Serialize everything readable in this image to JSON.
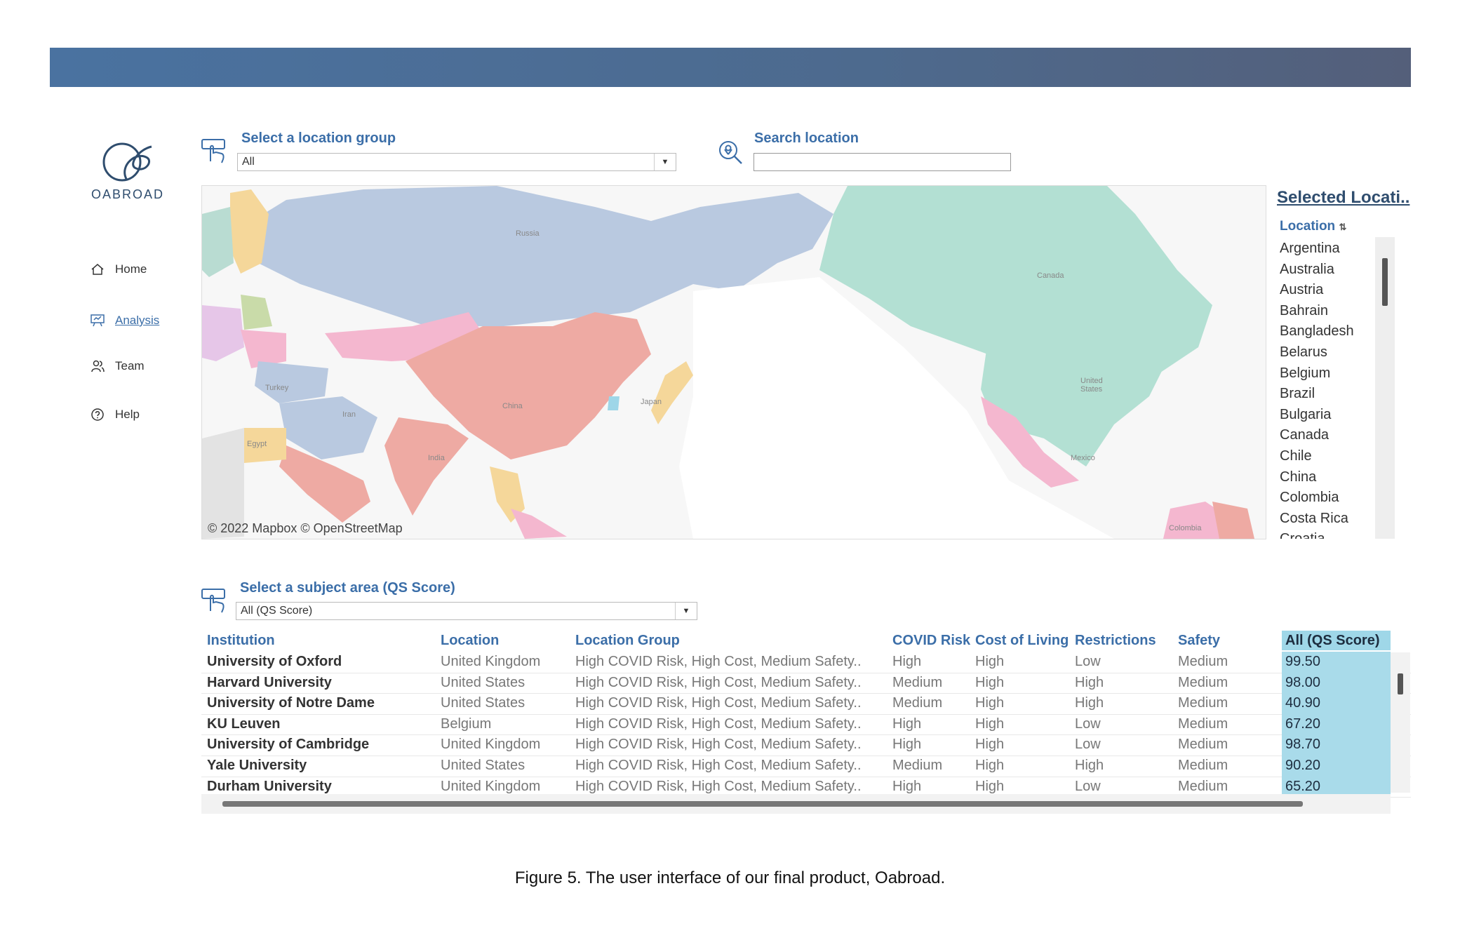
{
  "app": {
    "brand": "OABROAD"
  },
  "colors": {
    "topbar": "#4d6a8e",
    "accent": "#3b6ea8",
    "score_bg": "#a9dbea"
  },
  "nav": {
    "items": [
      {
        "label": "Home",
        "icon": "home-icon"
      },
      {
        "label": "Analysis",
        "icon": "presentation-icon",
        "active": true
      },
      {
        "label": "Team",
        "icon": "team-icon"
      },
      {
        "label": "Help",
        "icon": "help-icon"
      }
    ]
  },
  "filters": {
    "location_group": {
      "label": "Select a location group",
      "value": "All"
    },
    "search": {
      "label": "Search location",
      "value": ""
    },
    "subject": {
      "label": "Select a subject area (QS Score)",
      "value": "All (QS Score)"
    }
  },
  "map": {
    "credit": "© 2022 Mapbox © OpenStreetMap",
    "labels": [
      "Russia",
      "Canada",
      "United States",
      "China",
      "India",
      "Iran",
      "Turkey",
      "Egypt",
      "Japan",
      "Mexico",
      "Colombia"
    ]
  },
  "selected": {
    "title": "Selected Locati..",
    "column": "Location",
    "sort_icon": "sort-icon",
    "locations": [
      "Argentina",
      "Australia",
      "Austria",
      "Bahrain",
      "Bangladesh",
      "Belarus",
      "Belgium",
      "Brazil",
      "Bulgaria",
      "Canada",
      "Chile",
      "China",
      "Colombia",
      "Costa Rica",
      "Croatia"
    ]
  },
  "table": {
    "columns": [
      "Institution",
      "Location",
      "Location Group",
      "COVID Risk",
      "Cost of Living",
      "Restrictions",
      "Safety",
      "All (QS Score)"
    ],
    "rows": [
      [
        "University of Oxford",
        "United Kingdom",
        "High COVID Risk, High Cost, Medium Safety..",
        "High",
        "High",
        "Low",
        "Medium",
        "99.50"
      ],
      [
        "Harvard University",
        "United States",
        "High COVID Risk, High Cost, Medium Safety..",
        "Medium",
        "High",
        "High",
        "Medium",
        "98.00"
      ],
      [
        "University of Notre Dame",
        "United States",
        "High COVID Risk, High Cost, Medium Safety..",
        "Medium",
        "High",
        "High",
        "Medium",
        "40.90"
      ],
      [
        "KU Leuven",
        "Belgium",
        "High COVID Risk, High Cost, Medium Safety..",
        "High",
        "High",
        "Low",
        "Medium",
        "67.20"
      ],
      [
        "University of Cambridge",
        "United Kingdom",
        "High COVID Risk, High Cost, Medium Safety..",
        "High",
        "High",
        "Low",
        "Medium",
        "98.70"
      ],
      [
        "Yale University",
        "United States",
        "High COVID Risk, High Cost, Medium Safety..",
        "Medium",
        "High",
        "High",
        "Medium",
        "90.20"
      ],
      [
        "Durham University",
        "United Kingdom",
        "High COVID Risk, High Cost, Medium Safety..",
        "High",
        "High",
        "Low",
        "Medium",
        "65.20"
      ]
    ]
  },
  "caption": "Figure 5. The user interface of our final product, Oabroad."
}
